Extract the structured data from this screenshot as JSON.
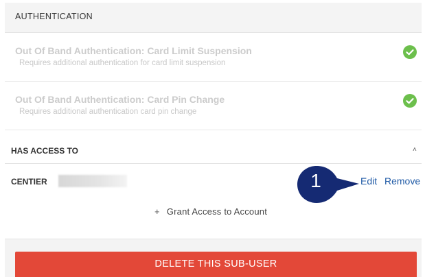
{
  "authentication": {
    "header": "AUTHENTICATION",
    "items": [
      {
        "title": "Out Of Band Authentication: Card Limit Suspension",
        "description": "Requires additional authentication for card limit suspension",
        "status_icon": "check-circle-icon"
      },
      {
        "title": "Out Of Band Authentication: Card Pin Change",
        "description": "Requires additional authentication card pin change",
        "status_icon": "check-circle-icon"
      }
    ]
  },
  "access": {
    "header": "HAS ACCESS TO",
    "collapse_glyph": "˄",
    "account_name": "CENTIER",
    "edit_label": "Edit",
    "remove_label": "Remove",
    "grant_plus": "+",
    "grant_label": "Grant Access to Account"
  },
  "callout": {
    "number": "1"
  },
  "footer": {
    "delete_label": "DELETE THIS SUB-USER"
  },
  "colors": {
    "check_green": "#6cbf4c",
    "link_blue": "#1f5aa6",
    "callout_navy": "#152a73",
    "delete_red": "#e34838"
  }
}
